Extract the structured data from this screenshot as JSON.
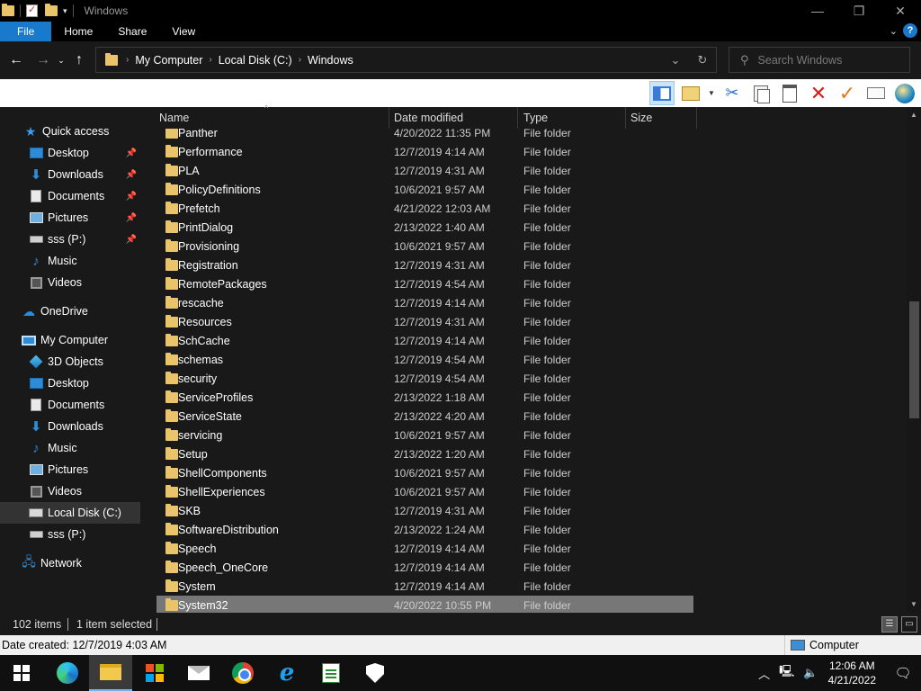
{
  "window": {
    "title": "Windows"
  },
  "ribbon": {
    "tabs": [
      "File",
      "Home",
      "Share",
      "View"
    ]
  },
  "address": {
    "crumbs": [
      "My Computer",
      "Local Disk (C:)",
      "Windows"
    ]
  },
  "search": {
    "placeholder": "Search Windows"
  },
  "nav": {
    "quick_access": "Quick access",
    "quick_items": [
      {
        "label": "Desktop",
        "icon": "desktop-icon",
        "pinned": true
      },
      {
        "label": "Downloads",
        "icon": "downloads-icon",
        "pinned": true
      },
      {
        "label": "Documents",
        "icon": "documents-icon",
        "pinned": true
      },
      {
        "label": "Pictures",
        "icon": "pictures-icon",
        "pinned": true
      },
      {
        "label": "sss (P:)",
        "icon": "drive-icon",
        "pinned": true
      },
      {
        "label": "Music",
        "icon": "music-icon",
        "pinned": false
      },
      {
        "label": "Videos",
        "icon": "videos-icon",
        "pinned": false
      }
    ],
    "onedrive": "OneDrive",
    "my_computer": "My Computer",
    "pc_items": [
      {
        "label": "3D Objects",
        "icon": "3d-objects-icon"
      },
      {
        "label": "Desktop",
        "icon": "desktop-icon"
      },
      {
        "label": "Documents",
        "icon": "documents-icon"
      },
      {
        "label": "Downloads",
        "icon": "downloads-icon"
      },
      {
        "label": "Music",
        "icon": "music-icon"
      },
      {
        "label": "Pictures",
        "icon": "pictures-icon"
      },
      {
        "label": "Videos",
        "icon": "videos-icon"
      },
      {
        "label": "Local Disk (C:)",
        "icon": "local-disk-icon",
        "selected": true
      },
      {
        "label": "sss (P:)",
        "icon": "drive-icon"
      }
    ],
    "network": "Network"
  },
  "columns": {
    "name": "Name",
    "date": "Date modified",
    "type": "Type",
    "size": "Size"
  },
  "files": [
    {
      "name": "Panther",
      "date": "4/20/2022 11:35 PM",
      "type": "File folder"
    },
    {
      "name": "Performance",
      "date": "12/7/2019 4:14 AM",
      "type": "File folder"
    },
    {
      "name": "PLA",
      "date": "12/7/2019 4:31 AM",
      "type": "File folder"
    },
    {
      "name": "PolicyDefinitions",
      "date": "10/6/2021 9:57 AM",
      "type": "File folder"
    },
    {
      "name": "Prefetch",
      "date": "4/21/2022 12:03 AM",
      "type": "File folder"
    },
    {
      "name": "PrintDialog",
      "date": "2/13/2022 1:40 AM",
      "type": "File folder"
    },
    {
      "name": "Provisioning",
      "date": "10/6/2021 9:57 AM",
      "type": "File folder"
    },
    {
      "name": "Registration",
      "date": "12/7/2019 4:31 AM",
      "type": "File folder"
    },
    {
      "name": "RemotePackages",
      "date": "12/7/2019 4:54 AM",
      "type": "File folder"
    },
    {
      "name": "rescache",
      "date": "12/7/2019 4:14 AM",
      "type": "File folder"
    },
    {
      "name": "Resources",
      "date": "12/7/2019 4:31 AM",
      "type": "File folder"
    },
    {
      "name": "SchCache",
      "date": "12/7/2019 4:14 AM",
      "type": "File folder"
    },
    {
      "name": "schemas",
      "date": "12/7/2019 4:54 AM",
      "type": "File folder"
    },
    {
      "name": "security",
      "date": "12/7/2019 4:54 AM",
      "type": "File folder"
    },
    {
      "name": "ServiceProfiles",
      "date": "2/13/2022 1:18 AM",
      "type": "File folder"
    },
    {
      "name": "ServiceState",
      "date": "2/13/2022 4:20 AM",
      "type": "File folder"
    },
    {
      "name": "servicing",
      "date": "10/6/2021 9:57 AM",
      "type": "File folder"
    },
    {
      "name": "Setup",
      "date": "2/13/2022 1:20 AM",
      "type": "File folder"
    },
    {
      "name": "ShellComponents",
      "date": "10/6/2021 9:57 AM",
      "type": "File folder"
    },
    {
      "name": "ShellExperiences",
      "date": "10/6/2021 9:57 AM",
      "type": "File folder"
    },
    {
      "name": "SKB",
      "date": "12/7/2019 4:31 AM",
      "type": "File folder"
    },
    {
      "name": "SoftwareDistribution",
      "date": "2/13/2022 1:24 AM",
      "type": "File folder"
    },
    {
      "name": "Speech",
      "date": "12/7/2019 4:14 AM",
      "type": "File folder"
    },
    {
      "name": "Speech_OneCore",
      "date": "12/7/2019 4:14 AM",
      "type": "File folder"
    },
    {
      "name": "System",
      "date": "12/7/2019 4:14 AM",
      "type": "File folder"
    },
    {
      "name": "System32",
      "date": "4/20/2022 10:55 PM",
      "type": "File folder",
      "selected": true
    }
  ],
  "status": {
    "count": "102 items",
    "selection": "1 item selected"
  },
  "details": {
    "created": "Date created: 12/7/2019 4:03 AM",
    "location": "Computer"
  },
  "taskbar": {
    "time": "12:06 AM",
    "date": "4/21/2022"
  },
  "colors": {
    "accent": "#1979ca",
    "folder": "#e9c46a",
    "background": "#191919",
    "selected_row": "#777777"
  }
}
